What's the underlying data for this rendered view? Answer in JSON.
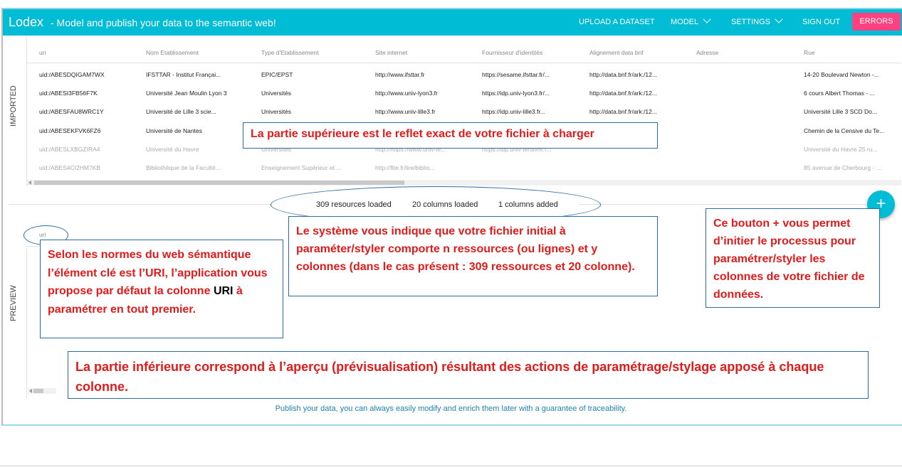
{
  "header": {
    "brand": "Lodex",
    "tagline": "- Model and publish your data to the semantic web!",
    "nav": {
      "upload": "UPLOAD A DATASET",
      "model": "MODEL",
      "settings": "SETTINGS",
      "signout": "SIGN OUT",
      "errors": "ERRORS"
    }
  },
  "sections": {
    "imported": "IMPORTED",
    "preview": "PREVIEW"
  },
  "table": {
    "columns": [
      "uri",
      "Nom Etablissement",
      "Type d'Etablissement",
      "Site internet",
      "Fournisseur d'identités",
      "Alignement data bnf",
      "Adresse",
      "Rue"
    ],
    "rows": [
      [
        "uid:/ABESDQIGAM7WX",
        "IFSTTAR - Institut Françai...",
        "EPIC/EPST",
        "http://www.ifsttar.fr",
        "https://sesame.ifsttar.fr/...",
        "http://data.bnf.fr/ark:/12...",
        "",
        "14-20 Boulevard Newton -..."
      ],
      [
        "uid:/ABESI3FB56F7K",
        "Université Jean Moulin Lyon 3",
        "Universités",
        "http://www.univ-lyon3.fr",
        "https://idp.univ-lyon3.fr/...",
        "http://data.bnf.fr/ark:/12...",
        "",
        "6 cours Albert Thomas - ..."
      ],
      [
        "uid:/ABESFAU8WRC1Y",
        "Université de Lille 3 scie...",
        "Universités",
        "http://www.univ-lille3.fr",
        "https://idp.univ-lille3.fr...",
        "http://data.bnf.fr/ark:/12...",
        "",
        "Université Lille 3 SCD Do..."
      ],
      [
        "uid:/ABESEKFVK6FZ6",
        "Université de Nantes",
        "",
        "",
        "",
        "",
        "",
        "Chemin de la Censive du Te..."
      ],
      [
        "uid:/ABESLXBGZIRA4",
        "Université du Havre",
        "Universités",
        "http://https://www.univ-le...",
        "https://idp.univ-lehavre.f...",
        "",
        "",
        "Université du Havre 25 ru..."
      ],
      [
        "uid:/ABES4CI2HM7KB",
        "Bibliothèque de la Faculté...",
        "Enseignement Supérieur et ...",
        "http://ftte.fr/lire/biblio...",
        "",
        "",
        "",
        "85 avenue de Cherbourg - ..."
      ]
    ]
  },
  "stats": {
    "resources": "309 resources loaded",
    "columns": "20 columns loaded",
    "added": "1 columns added"
  },
  "preview": {
    "column": "uri"
  },
  "fab": {
    "label": "+"
  },
  "callouts": {
    "top": "La partie supérieure est le reflet exact de votre fichier à charger",
    "system": "Le système vous indique que votre fichier initial à paraméter/styler comporte n ressources (ou lignes) et y colonnes (dans le cas présent : 309 ressources et 20 colonne).",
    "button": "Ce bouton + vous permet d’initier le processus pour paramétrer/styler les colonnes de votre fichier de données.",
    "uri_before": "Selon les normes du web sémantique l’élément clé est l’URI, l’application vous propose par défaut la colonne",
    "uri_keyword": "URI",
    "uri_after": "à paramétrer en tout premier.",
    "bottom": "La partie inférieure correspond à l’aperçu (prévisualisation) résultant des actions de paramétrage/stylage apposé à chaque colonne."
  },
  "footer": "Publish your data, you can always easily modify and enrich them later with a guarantee of traceability.",
  "colors": {
    "primary": "#00bcd4",
    "accent": "#ff4081",
    "callout_border": "#2e6aa3",
    "callout_text": "#e01b1b"
  }
}
